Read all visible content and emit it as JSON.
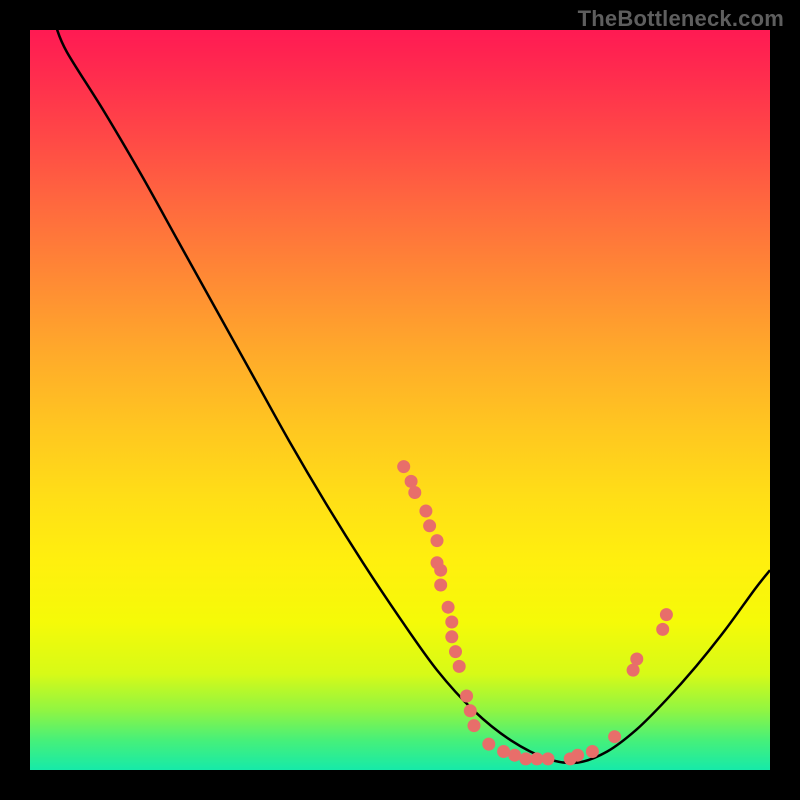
{
  "watermark": "TheBottleneck.com",
  "chart_data": {
    "type": "line",
    "title": "",
    "xlabel": "",
    "ylabel": "",
    "xlim": [
      0,
      100
    ],
    "ylim": [
      0,
      100
    ],
    "curve": [
      {
        "x": 3.5,
        "y": 100.5
      },
      {
        "x": 5,
        "y": 97
      },
      {
        "x": 10,
        "y": 89
      },
      {
        "x": 15,
        "y": 80.5
      },
      {
        "x": 20,
        "y": 71.5
      },
      {
        "x": 25,
        "y": 62.5
      },
      {
        "x": 30,
        "y": 53.5
      },
      {
        "x": 35,
        "y": 44.5
      },
      {
        "x": 40,
        "y": 36
      },
      {
        "x": 45,
        "y": 28
      },
      {
        "x": 50,
        "y": 20.5
      },
      {
        "x": 55,
        "y": 13.5
      },
      {
        "x": 60,
        "y": 8
      },
      {
        "x": 65,
        "y": 4
      },
      {
        "x": 70,
        "y": 1.5
      },
      {
        "x": 74,
        "y": 1
      },
      {
        "x": 78,
        "y": 2.5
      },
      {
        "x": 82,
        "y": 5.5
      },
      {
        "x": 86,
        "y": 9.5
      },
      {
        "x": 90,
        "y": 14
      },
      {
        "x": 94,
        "y": 19
      },
      {
        "x": 98,
        "y": 24.5
      },
      {
        "x": 100,
        "y": 27
      }
    ],
    "points": [
      {
        "x": 50.5,
        "y": 41
      },
      {
        "x": 51.5,
        "y": 39
      },
      {
        "x": 52,
        "y": 37.5
      },
      {
        "x": 53.5,
        "y": 35
      },
      {
        "x": 54,
        "y": 33
      },
      {
        "x": 55,
        "y": 31
      },
      {
        "x": 55,
        "y": 28
      },
      {
        "x": 55.5,
        "y": 27
      },
      {
        "x": 55.5,
        "y": 25
      },
      {
        "x": 56.5,
        "y": 22
      },
      {
        "x": 57,
        "y": 20
      },
      {
        "x": 57,
        "y": 18
      },
      {
        "x": 57.5,
        "y": 16
      },
      {
        "x": 58,
        "y": 14
      },
      {
        "x": 59,
        "y": 10
      },
      {
        "x": 59.5,
        "y": 8
      },
      {
        "x": 60,
        "y": 6
      },
      {
        "x": 62,
        "y": 3.5
      },
      {
        "x": 64,
        "y": 2.5
      },
      {
        "x": 65.5,
        "y": 2
      },
      {
        "x": 67,
        "y": 1.5
      },
      {
        "x": 68.5,
        "y": 1.5
      },
      {
        "x": 70,
        "y": 1.5
      },
      {
        "x": 73,
        "y": 1.5
      },
      {
        "x": 74,
        "y": 2
      },
      {
        "x": 76,
        "y": 2.5
      },
      {
        "x": 79,
        "y": 4.5
      },
      {
        "x": 81.5,
        "y": 13.5
      },
      {
        "x": 82,
        "y": 15
      },
      {
        "x": 85.5,
        "y": 19
      },
      {
        "x": 86,
        "y": 21
      }
    ],
    "curve_color": "#000000",
    "point_color": "#e86e6a",
    "point_radius": 6.5
  }
}
